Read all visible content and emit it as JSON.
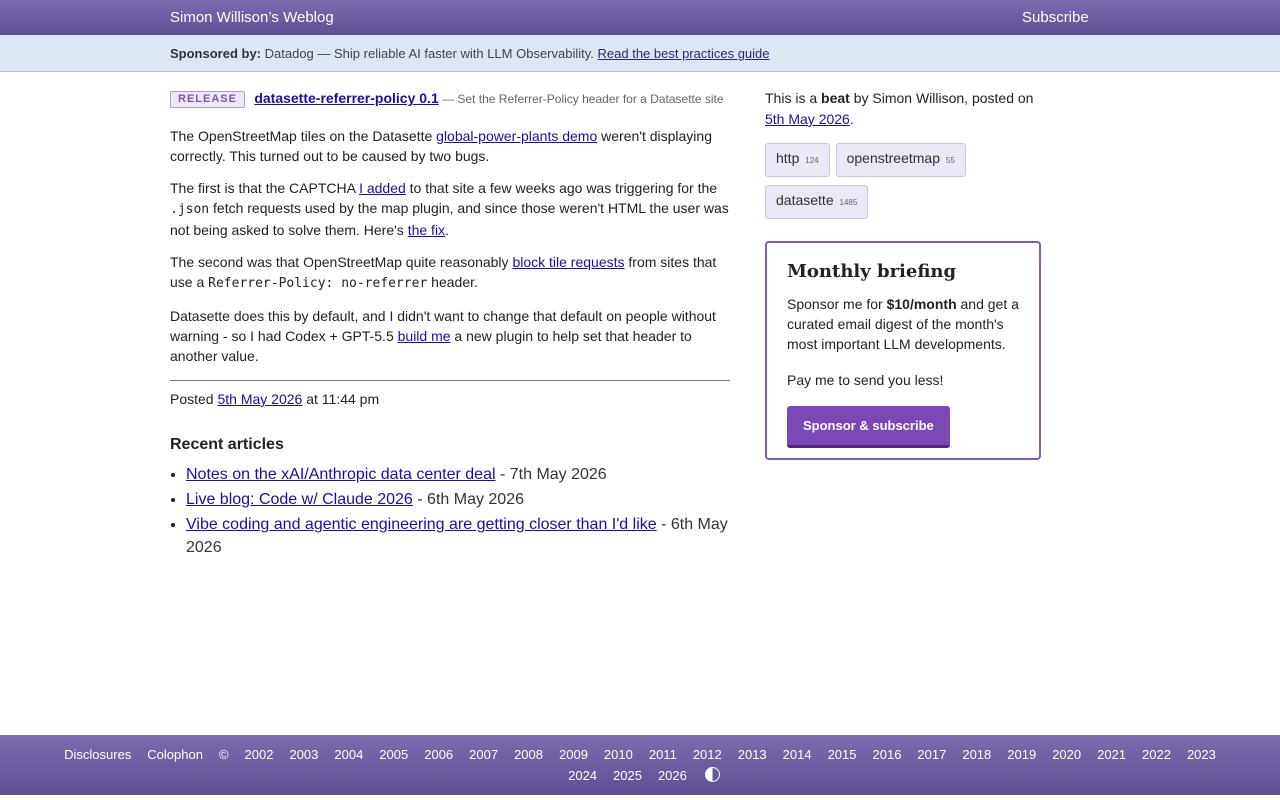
{
  "header": {
    "site_title": "Simon Willison’s Weblog",
    "subscribe": "Subscribe"
  },
  "sponsor": {
    "label": "Sponsored by:",
    "text": "Datadog — Ship reliable AI faster with LLM Observability.",
    "link": "Read the best practices guide"
  },
  "post": {
    "badge": "RELEASE",
    "title": "datasette-referrer-policy 0.1",
    "summary": "— Set the Referrer-Policy header for a Datasette site",
    "p1_a": "The OpenStreetMap tiles on the Datasette ",
    "p1_link": "global-power-plants demo",
    "p1_b": " weren't displaying correctly. This turned out to be caused by two bugs.",
    "p2_a": "The first is that the CAPTCHA ",
    "p2_link": "I added",
    "p2_b": " to that site a few weeks ago was triggering for the ",
    "p2_code": ".json",
    "p2_c": " fetch requests used by the map plugin, and since those weren't HTML the user was not being asked to solve them. Here's ",
    "p2_link2": "the fix",
    "p2_d": ".",
    "p3_a": "The second was that OpenStreetMap quite reasonably ",
    "p3_link": "block tile requests",
    "p3_b": " from sites that use a ",
    "p3_code": "Referrer-Policy: no-referrer",
    "p3_c": " header.",
    "p4_a": "Datasette does this by default, and I didn't want to change that default on people without warning - so I had Codex + GPT-5.5 ",
    "p4_link": "build me",
    "p4_b": " a new plugin to help set that header to another value.",
    "posted_label": "Posted ",
    "posted_date": "5th May 2026",
    "posted_time": " at 11:44 pm"
  },
  "recent": {
    "heading": "Recent articles",
    "items": [
      {
        "title": "Notes on the xAI/Anthropic data center deal",
        "date": " - 7th May 2026"
      },
      {
        "title": "Live blog: Code w/ Claude 2026",
        "date": " - 6th May 2026"
      },
      {
        "title": "Vibe coding and agentic engineering are getting closer than I'd like",
        "date": " - 6th May 2026"
      }
    ]
  },
  "sidebar": {
    "intro_a": "This is a ",
    "intro_b": "beat",
    "intro_c": " by Simon Willison, posted on ",
    "intro_date": "5th May 2026",
    "intro_d": ".",
    "tags": [
      {
        "name": "http",
        "count": "124"
      },
      {
        "name": "openstreetmap",
        "count": "55"
      },
      {
        "name": "datasette",
        "count": "1485"
      }
    ],
    "briefing": {
      "title": "Monthly briefing",
      "text_a": "Sponsor me for ",
      "text_b": "$10/month",
      "text_c": " and get a curated email digest of the month's most important LLM developments.",
      "text2": "Pay me to send you less!",
      "button": "Sponsor & subscribe"
    }
  },
  "footer": {
    "links": [
      "Disclosures",
      "Colophon",
      "©",
      "2002",
      "2003",
      "2004",
      "2005",
      "2006",
      "2007",
      "2008",
      "2009",
      "2010",
      "2011",
      "2012",
      "2013",
      "2014",
      "2015",
      "2016",
      "2017",
      "2018",
      "2019",
      "2020",
      "2021",
      "2022",
      "2023"
    ],
    "links2": [
      "2024",
      "2025",
      "2026"
    ]
  },
  "colors": {
    "header": "#6d5ca4",
    "accent": "#7b49b5",
    "link": "#1a0dab"
  }
}
